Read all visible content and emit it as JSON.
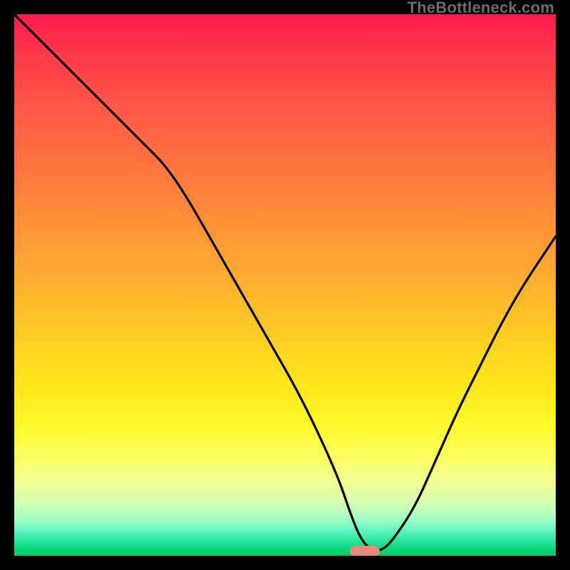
{
  "watermark": "TheBottleneck.com",
  "marker": {
    "x_pct": 64.7,
    "y_pct": 99.2,
    "color": "#e8887d"
  },
  "chart_data": {
    "type": "line",
    "title": "",
    "xlabel": "",
    "ylabel": "",
    "xlim": [
      0,
      100
    ],
    "ylim": [
      0,
      100
    ],
    "grid": false,
    "legend": false,
    "series": [
      {
        "name": "bottleneck-curve",
        "x": [
          0,
          5,
          10,
          15,
          20,
          24,
          28,
          32,
          36,
          40,
          44,
          48,
          52,
          56,
          60,
          62,
          64,
          66,
          68,
          70,
          74,
          78,
          82,
          86,
          90,
          94,
          98,
          100
        ],
        "y": [
          100,
          95,
          90,
          85,
          80,
          76,
          72,
          66,
          59,
          52,
          45,
          38,
          31,
          23,
          14,
          8,
          3,
          1,
          1,
          3,
          9,
          18,
          27,
          35,
          43,
          50,
          56,
          59
        ]
      }
    ],
    "marker": {
      "x": 65,
      "y": 0.8
    },
    "background_gradient": {
      "stops": [
        {
          "pct": 0,
          "color": "#ff1a4d"
        },
        {
          "pct": 18,
          "color": "#ff5946"
        },
        {
          "pct": 45,
          "color": "#ffa233"
        },
        {
          "pct": 68,
          "color": "#ffe61a"
        },
        {
          "pct": 86,
          "color": "#f2ff8e"
        },
        {
          "pct": 95,
          "color": "#6cf7c2"
        },
        {
          "pct": 100,
          "color": "#04c964"
        }
      ]
    }
  }
}
